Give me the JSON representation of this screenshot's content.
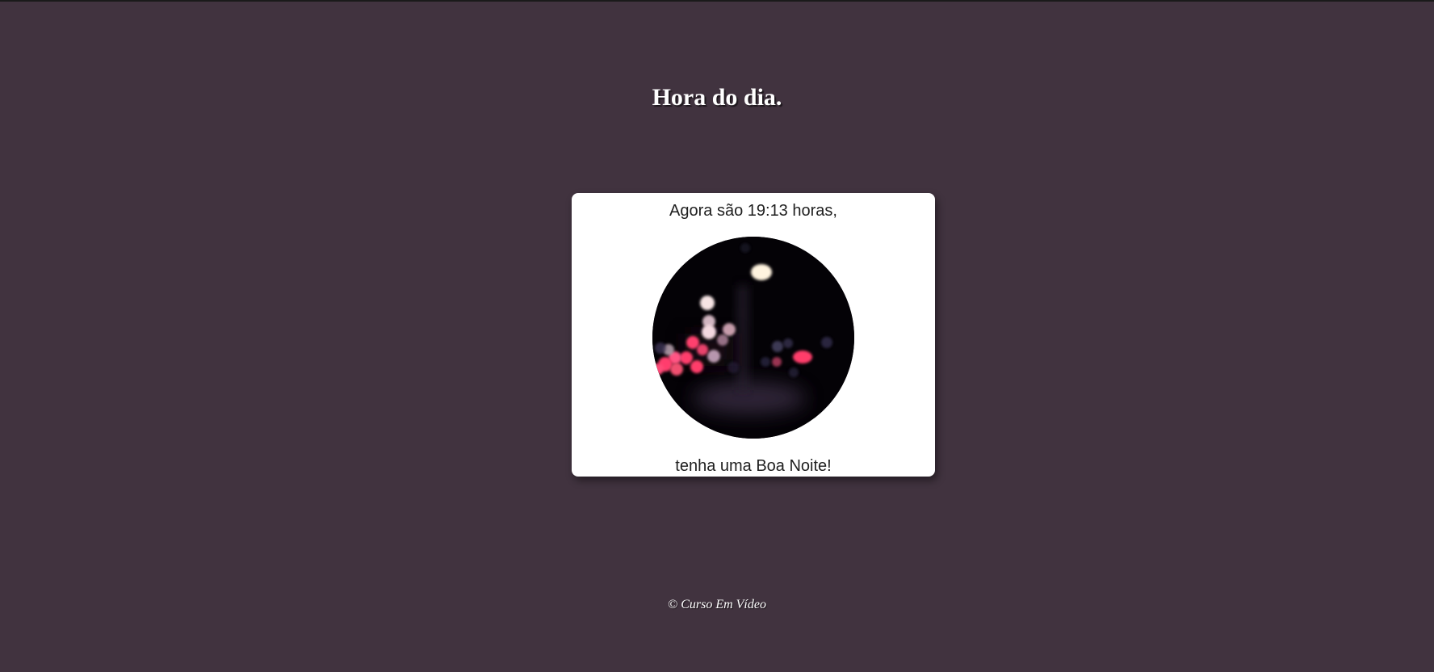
{
  "page": {
    "title": "Hora do dia.",
    "background_color": "#41333f"
  },
  "card": {
    "time_message": "Agora são 19:13 horas,",
    "greeting": "tenha uma Boa Noite!",
    "image_subject": "night-bokeh-city-lights"
  },
  "footer": {
    "copyright": "© Curso Em Vídeo"
  }
}
